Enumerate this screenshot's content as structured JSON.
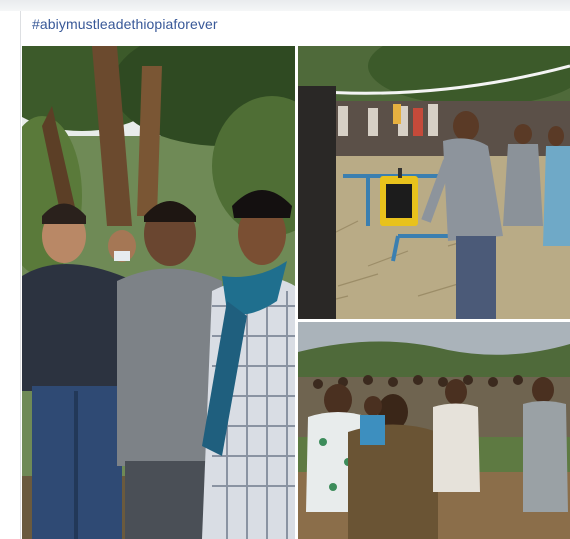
{
  "post": {
    "hashtag": "#abiymustleadethiopiaforever"
  },
  "gallery": {
    "photos": [
      {
        "description_icon": "photo-group-portrait"
      },
      {
        "description_icon": "photo-field-equipment"
      },
      {
        "description_icon": "photo-crowd-outdoor"
      }
    ]
  },
  "colors": {
    "link": "#385898",
    "divider": "#dddfe2"
  }
}
